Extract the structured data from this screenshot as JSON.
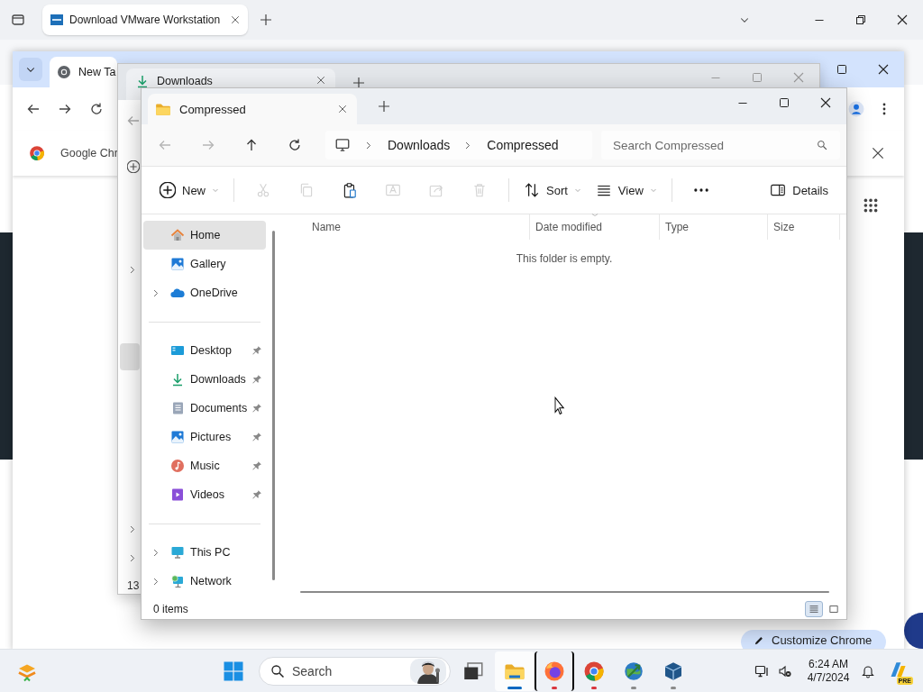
{
  "browser_back": {
    "tab": {
      "title": "Download VMware Workstation"
    }
  },
  "browser_front": {
    "tab": {
      "title": "New Ta"
    },
    "infobar": {
      "text": "Google Chr"
    },
    "customize_button": {
      "label": "Customize Chrome"
    }
  },
  "explorer_back": {
    "tab": {
      "title": "Downloads"
    },
    "sidebar_count": "13"
  },
  "explorer": {
    "tab": {
      "title": "Compressed"
    },
    "nav": [
      {
        "kind": "back",
        "disabled": true
      },
      {
        "kind": "forward",
        "disabled": true
      },
      {
        "kind": "up",
        "disabled": false
      },
      {
        "kind": "refresh",
        "disabled": false
      }
    ],
    "breadcrumb": [
      "Downloads",
      "Compressed"
    ],
    "search": {
      "placeholder": "Search Compressed"
    },
    "toolbar": [
      {
        "kind": "new",
        "label": "New",
        "dropdown": true,
        "disabled": false
      },
      {
        "kind": "separator"
      },
      {
        "kind": "cut",
        "disabled": true
      },
      {
        "kind": "copy",
        "disabled": true
      },
      {
        "kind": "paste",
        "disabled": false
      },
      {
        "kind": "rename",
        "disabled": true
      },
      {
        "kind": "share",
        "disabled": true
      },
      {
        "kind": "delete",
        "disabled": true
      },
      {
        "kind": "separator"
      },
      {
        "kind": "sort",
        "label": "Sort",
        "dropdown": true,
        "disabled": false
      },
      {
        "kind": "view",
        "label": "View",
        "dropdown": true,
        "disabled": false
      },
      {
        "kind": "separator"
      },
      {
        "kind": "more",
        "disabled": false
      },
      {
        "kind": "details",
        "label": "Details",
        "dropdown": false,
        "disabled": false
      }
    ],
    "sidebar": [
      [
        {
          "label": "Home",
          "kind": "home",
          "selected": true,
          "pinned": false,
          "expandable": false
        },
        {
          "label": "Gallery",
          "kind": "gallery",
          "selected": false,
          "pinned": false,
          "expandable": false
        },
        {
          "label": "OneDrive",
          "kind": "onedrive",
          "selected": false,
          "pinned": false,
          "expandable": true
        }
      ],
      [
        {
          "label": "Desktop",
          "kind": "desktop",
          "selected": false,
          "pinned": true,
          "expandable": false
        },
        {
          "label": "Downloads",
          "kind": "downloads",
          "selected": false,
          "pinned": true,
          "expandable": false
        },
        {
          "label": "Documents",
          "kind": "documents",
          "selected": false,
          "pinned": true,
          "expandable": false
        },
        {
          "label": "Pictures",
          "kind": "pictures",
          "selected": false,
          "pinned": true,
          "expandable": false
        },
        {
          "label": "Music",
          "kind": "music",
          "selected": false,
          "pinned": true,
          "expandable": false
        },
        {
          "label": "Videos",
          "kind": "videos",
          "selected": false,
          "pinned": true,
          "expandable": false
        }
      ],
      [
        {
          "label": "This PC",
          "kind": "thispc",
          "selected": false,
          "pinned": false,
          "expandable": true
        },
        {
          "label": "Network",
          "kind": "network",
          "selected": false,
          "pinned": false,
          "expandable": true
        }
      ]
    ],
    "columns": [
      {
        "label": "Name",
        "sorted": false
      },
      {
        "label": "Date modified",
        "sorted": true
      },
      {
        "label": "Type",
        "sorted": false
      },
      {
        "label": "Size",
        "sorted": false
      }
    ],
    "empty_message": "This folder is empty.",
    "status": "0 items",
    "views": [
      {
        "kind": "details",
        "selected": true
      },
      {
        "kind": "tiles",
        "selected": false
      }
    ]
  },
  "taskbar": {
    "search": {
      "label": "Search"
    },
    "apps": [
      {
        "kind": "explorer",
        "active": true,
        "highlighted": false,
        "color": "#0067c0"
      },
      {
        "kind": "firefox",
        "active": false,
        "highlighted": true,
        "color": "#d9363e"
      },
      {
        "kind": "chrome",
        "active": false,
        "highlighted": false,
        "color": "#d9363e"
      },
      {
        "kind": "globe",
        "active": false,
        "highlighted": false,
        "color": "#8a8a8a"
      },
      {
        "kind": "cube",
        "active": false,
        "highlighted": false,
        "color": "#8a8a8a"
      }
    ],
    "time": "6:24 AM",
    "date": "4/7/2024",
    "copilot_badge": "PRE"
  }
}
